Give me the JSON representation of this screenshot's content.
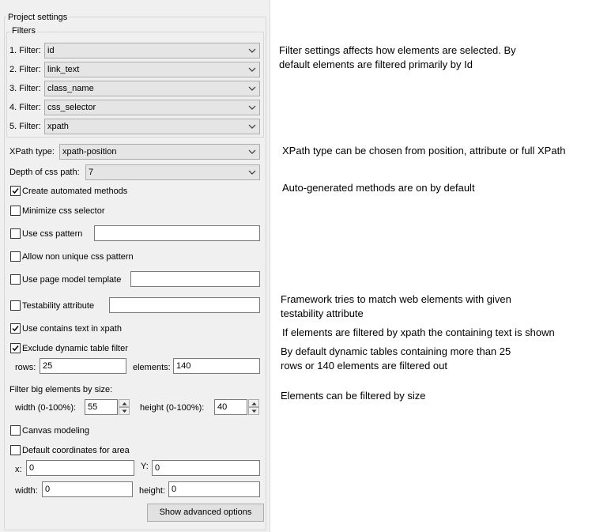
{
  "project_settings": {
    "title": "Project settings",
    "filters": {
      "title": "Filters",
      "items": [
        {
          "label": "1. Filter:",
          "value": "id"
        },
        {
          "label": "2. Filter:",
          "value": "link_text"
        },
        {
          "label": "3. Filter:",
          "value": "class_name"
        },
        {
          "label": "4. Filter:",
          "value": "css_selector"
        },
        {
          "label": "5. Filter:",
          "value": "xpath"
        }
      ]
    },
    "xpath_type": {
      "label": "XPath type:",
      "value": "xpath-position"
    },
    "depth_css_path": {
      "label": "Depth of css path:",
      "value": "7"
    },
    "create_automated_methods": {
      "label": "Create automated methods",
      "checked": true
    },
    "minimize_css_selector": {
      "label": "Minimize css selector",
      "checked": false
    },
    "use_css_pattern": {
      "label": "Use css pattern",
      "checked": false,
      "value": ""
    },
    "allow_non_unique_css_pattern": {
      "label": "Allow non unique css pattern",
      "checked": false
    },
    "use_page_model_template": {
      "label": "Use page model template",
      "checked": false,
      "value": ""
    },
    "testability_attribute": {
      "label": "Testability attribute",
      "checked": false,
      "value": ""
    },
    "use_contains_text_xpath": {
      "label": "Use contains text in xpath",
      "checked": true
    },
    "exclude_dynamic_table_filter": {
      "label": "Exclude dynamic table filter",
      "checked": true
    },
    "rows": {
      "label": "rows:",
      "value": "25"
    },
    "elements": {
      "label": "elements:",
      "value": "140"
    },
    "filter_big_elements": {
      "label": "Filter big elements by size:"
    },
    "width": {
      "label": "width (0-100%):",
      "value": "55"
    },
    "height": {
      "label": "height (0-100%):",
      "value": "40"
    },
    "canvas_modeling": {
      "label": "Canvas modeling",
      "checked": false
    },
    "default_coordinates": {
      "label": "Default coordinates for area",
      "checked": false
    },
    "coord_x": {
      "label": "x:",
      "value": "0"
    },
    "coord_y": {
      "label": "Y:",
      "value": "0"
    },
    "coord_width": {
      "label": "width:",
      "value": "0"
    },
    "coord_height": {
      "label": "height:",
      "value": "0"
    },
    "advanced_button": {
      "label": "Show advanced options"
    }
  },
  "annotations": {
    "filters_note_1": "Filter settings affects how elements are selected. By",
    "filters_note_2": "default elements are filtered primarily by Id",
    "xpath_note": "XPath type can be chosen from position, attribute or full XPath",
    "auto_methods_note": "Auto-generated methods are on by default",
    "testability_note_1": "Framework tries to match web elements with given",
    "testability_note_2": "testability attribute",
    "contains_text_note": "If elements are filtered by xpath the containing text is shown",
    "dynamic_tables_note_1": "By default dynamic tables containing more than 25",
    "dynamic_tables_note_2": "rows or 140 elements are filtered out",
    "size_note": "Elements can be filtered by size"
  }
}
